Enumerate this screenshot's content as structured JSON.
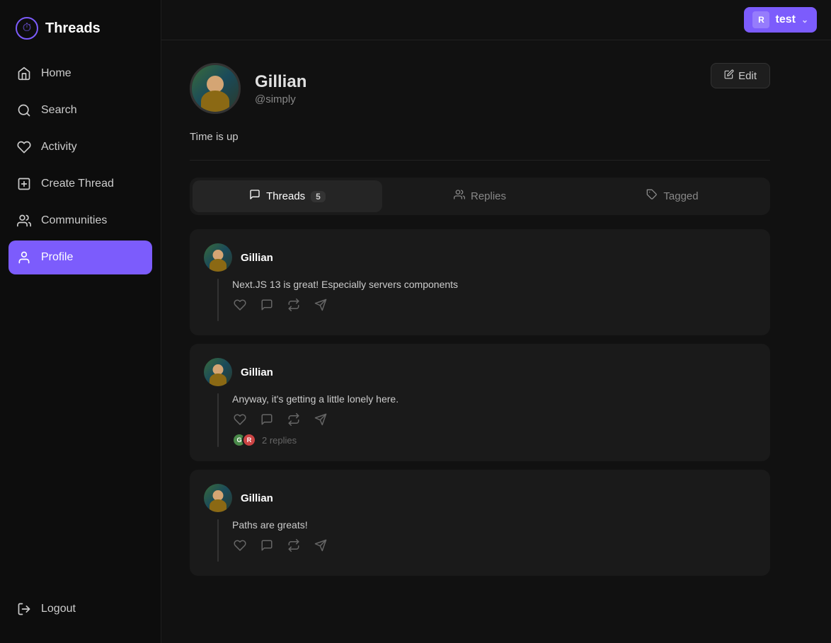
{
  "app": {
    "title": "Threads",
    "logo": "⏱"
  },
  "workspace": {
    "name": "test",
    "icon": "R"
  },
  "sidebar": {
    "items": [
      {
        "id": "home",
        "label": "Home",
        "icon": "⌂"
      },
      {
        "id": "search",
        "label": "Search",
        "icon": "○"
      },
      {
        "id": "activity",
        "label": "Activity",
        "icon": "♡"
      },
      {
        "id": "create-thread",
        "label": "Create Thread",
        "icon": "⊕"
      },
      {
        "id": "communities",
        "label": "Communities",
        "icon": "⊕"
      },
      {
        "id": "profile",
        "label": "Profile",
        "icon": "◎",
        "active": true
      }
    ],
    "logout": {
      "label": "Logout",
      "icon": "↩"
    }
  },
  "profile": {
    "name": "Gillian",
    "handle": "@simply",
    "bio": "Time is up",
    "edit_btn": "Edit"
  },
  "tabs": [
    {
      "id": "threads",
      "label": "Threads",
      "badge": "5",
      "active": true
    },
    {
      "id": "replies",
      "label": "Replies",
      "badge": null,
      "active": false
    },
    {
      "id": "tagged",
      "label": "Tagged",
      "badge": null,
      "active": false
    }
  ],
  "threads": [
    {
      "id": 1,
      "author": "Gillian",
      "text": "Next.JS 13 is great! Especially servers components",
      "replies_count": null,
      "reply_avatars": []
    },
    {
      "id": 2,
      "author": "Gillian",
      "text": "Anyway, it's getting a little lonely here.",
      "replies_count": "2 replies",
      "reply_avatars": [
        "G",
        "R"
      ]
    },
    {
      "id": 3,
      "author": "Gillian",
      "text": "Paths are greats!",
      "replies_count": null,
      "reply_avatars": []
    }
  ]
}
